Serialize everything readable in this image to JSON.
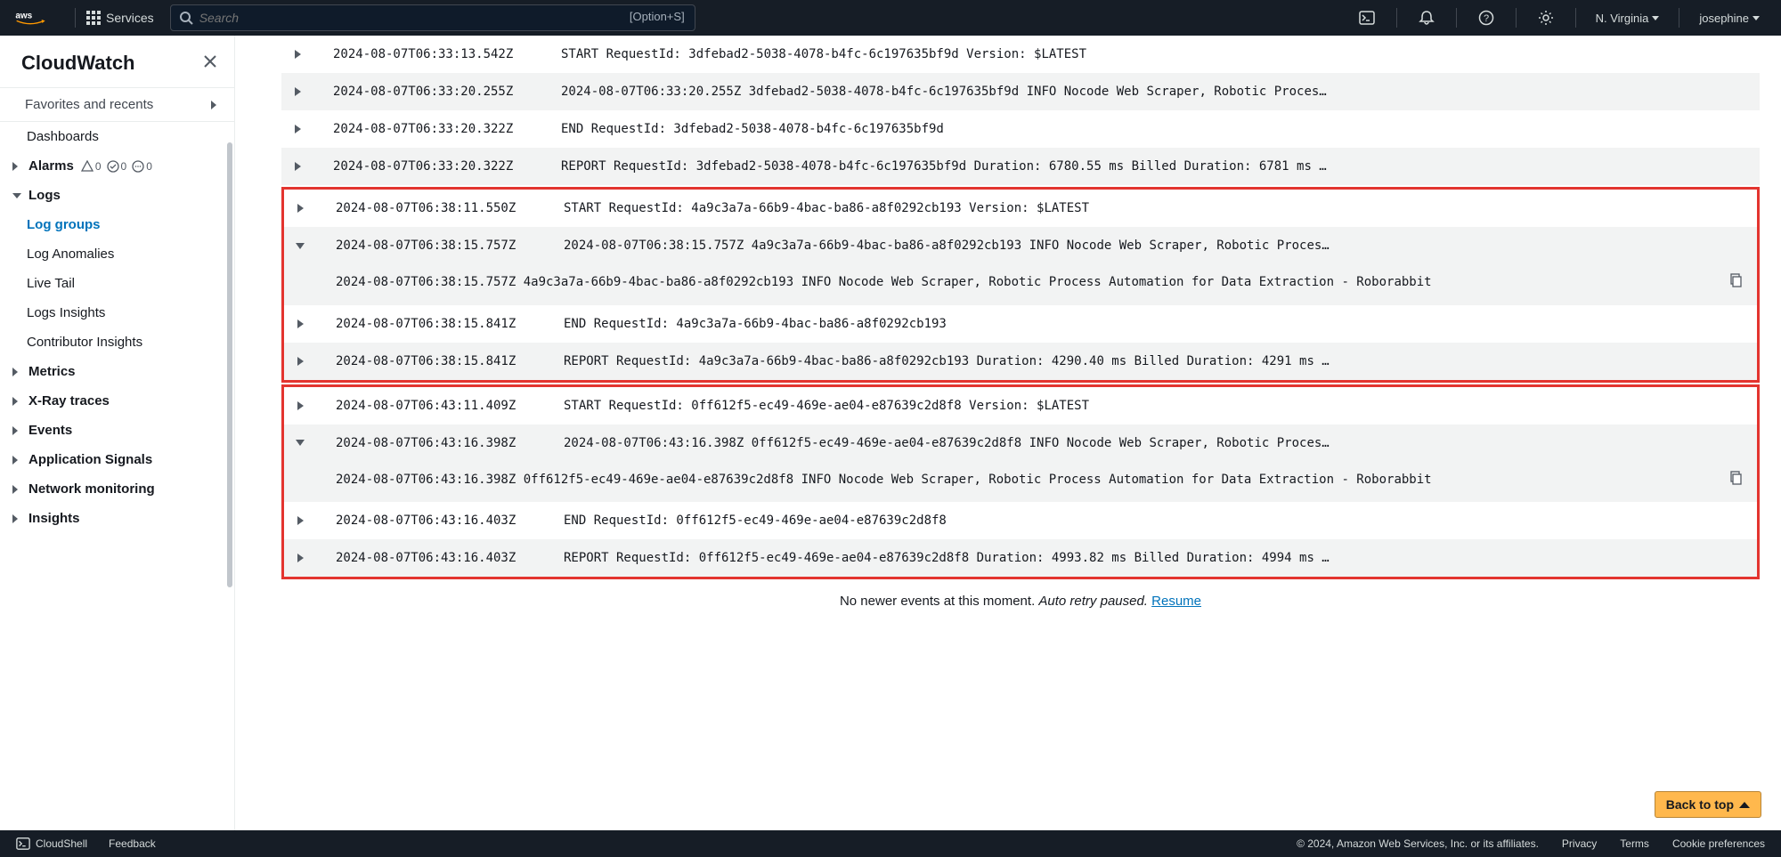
{
  "topnav": {
    "services_label": "Services",
    "search_placeholder": "Search",
    "search_shortcut": "[Option+S]",
    "region": "N. Virginia",
    "user": "josephine"
  },
  "sidebar": {
    "title": "CloudWatch",
    "favorites": "Favorites and recents",
    "dashboards": "Dashboards",
    "alarms": {
      "label": "Alarms",
      "triangle": "0",
      "check": "0",
      "dots": "0"
    },
    "logs": {
      "label": "Logs",
      "items": [
        "Log groups",
        "Log Anomalies",
        "Live Tail",
        "Logs Insights",
        "Contributor Insights"
      ],
      "active_index": 0
    },
    "rest": [
      "Metrics",
      "X-Ray traces",
      "Events",
      "Application Signals",
      "Network monitoring",
      "Insights"
    ]
  },
  "logs": {
    "rows": [
      {
        "expanded": false,
        "striped": false,
        "ts": "2024-08-07T06:33:13.542Z",
        "msg": "START RequestId: 3dfebad2-5038-4078-b4fc-6c197635bf9d Version: $LATEST"
      },
      {
        "expanded": false,
        "striped": true,
        "ts": "2024-08-07T06:33:20.255Z",
        "msg": "2024-08-07T06:33:20.255Z 3dfebad2-5038-4078-b4fc-6c197635bf9d INFO Nocode Web Scraper, Robotic Proces…"
      },
      {
        "expanded": false,
        "striped": false,
        "ts": "2024-08-07T06:33:20.322Z",
        "msg": "END RequestId: 3dfebad2-5038-4078-b4fc-6c197635bf9d"
      },
      {
        "expanded": false,
        "striped": true,
        "ts": "2024-08-07T06:33:20.322Z",
        "msg": "REPORT RequestId: 3dfebad2-5038-4078-b4fc-6c197635bf9d Duration: 6780.55 ms Billed Duration: 6781 ms  …"
      }
    ],
    "group1": {
      "rows": [
        {
          "expanded": false,
          "striped": false,
          "ts_ul": true,
          "ts": "2024-08-07T06:38:11.550Z",
          "msg": "START RequestId: 4a9c3a7a-66b9-4bac-ba86-a8f0292cb193 Version: $LATEST"
        },
        {
          "expanded": true,
          "striped": true,
          "ts": "2024-08-07T06:38:15.757Z",
          "msg": "2024-08-07T06:38:15.757Z 4a9c3a7a-66b9-4bac-ba86-a8f0292cb193 INFO Nocode Web Scraper, Robotic Proces…",
          "body": "2024-08-07T06:38:15.757Z      4a9c3a7a-66b9-4bac-ba86-a8f0292cb193     INFO    Nocode Web Scraper, Robotic Process Automation for Data Extraction - Roborabbit"
        },
        {
          "expanded": false,
          "striped": false,
          "ts": "2024-08-07T06:38:15.841Z",
          "msg": "END RequestId: 4a9c3a7a-66b9-4bac-ba86-a8f0292cb193"
        },
        {
          "expanded": false,
          "striped": true,
          "ts": "2024-08-07T06:38:15.841Z",
          "msg": "REPORT RequestId: 4a9c3a7a-66b9-4bac-ba86-a8f0292cb193 Duration: 4290.40 ms Billed Duration: 4291 ms  …"
        }
      ]
    },
    "group2": {
      "rows": [
        {
          "expanded": false,
          "striped": false,
          "ts_ul": true,
          "ts": "2024-08-07T06:43:11.409Z",
          "msg": "START RequestId: 0ff612f5-ec49-469e-ae04-e87639c2d8f8 Version: $LATEST"
        },
        {
          "expanded": true,
          "striped": true,
          "ts": "2024-08-07T06:43:16.398Z",
          "msg": "2024-08-07T06:43:16.398Z 0ff612f5-ec49-469e-ae04-e87639c2d8f8 INFO Nocode Web Scraper, Robotic Proces…",
          "body": "2024-08-07T06:43:16.398Z      0ff612f5-ec49-469e-ae04-e87639c2d8f8     INFO    Nocode Web Scraper, Robotic Process Automation for Data Extraction - Roborabbit"
        },
        {
          "expanded": false,
          "striped": false,
          "ts": "2024-08-07T06:43:16.403Z",
          "msg": "END RequestId: 0ff612f5-ec49-469e-ae04-e87639c2d8f8"
        },
        {
          "expanded": false,
          "striped": true,
          "ts": "2024-08-07T06:43:16.403Z",
          "msg": "REPORT RequestId: 0ff612f5-ec49-469e-ae04-e87639c2d8f8 Duration: 4993.82 ms Billed Duration: 4994 ms  …"
        }
      ]
    },
    "footer_plain": "No newer events at this moment. ",
    "footer_italic": "Auto retry paused. ",
    "footer_link": "Resume"
  },
  "back_to_top": "Back to top",
  "bottombar": {
    "cloudshell": "CloudShell",
    "feedback": "Feedback",
    "copyright": "© 2024, Amazon Web Services, Inc. or its affiliates.",
    "privacy": "Privacy",
    "terms": "Terms",
    "cookies": "Cookie preferences"
  }
}
